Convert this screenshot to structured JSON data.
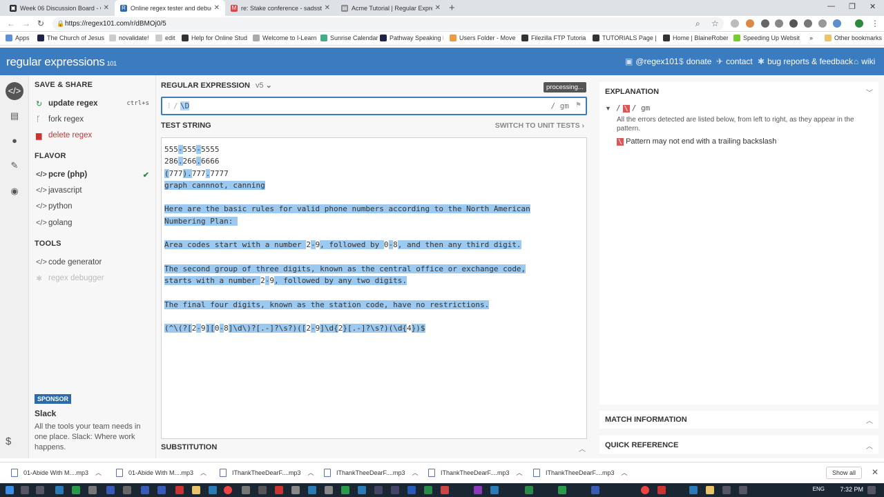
{
  "browser": {
    "tabs": [
      {
        "title": "Week 06 Discussion Board - CIT",
        "color": "#222"
      },
      {
        "title": "Online regex tester and debugge",
        "color": "#2d6aa8"
      },
      {
        "title": "re: Stake conference - sadsster@",
        "color": "#d44"
      },
      {
        "title": "Acme Tutorial | Regular Expressio",
        "color": "#666"
      }
    ],
    "url": "https://regex101.com/r/dBMOj0/5",
    "bookmarks": [
      {
        "label": "Apps",
        "color": "#5f8fd8"
      },
      {
        "label": "The Church of Jesus",
        "color": "#224"
      },
      {
        "label": "novalidate!",
        "color": "#999"
      },
      {
        "label": "edit",
        "color": "#999"
      },
      {
        "label": "Help for Online Stud",
        "color": "#333"
      },
      {
        "label": "Welcome to I-Learn",
        "color": "#aaa"
      },
      {
        "label": "Sunrise Calendar",
        "color": "#4a8"
      },
      {
        "label": "Pathway Speaking Pa",
        "color": "#224"
      },
      {
        "label": "Users Folder - Move",
        "color": "#e94"
      },
      {
        "label": "Filezilla FTP Tutorial",
        "color": "#333"
      },
      {
        "label": "TUTORIALS Page | Bl",
        "color": "#333"
      },
      {
        "label": "Home | BlaineRobert",
        "color": "#333"
      },
      {
        "label": "Speeding Up Websit",
        "color": "#7c3"
      },
      {
        "label": "Other bookmarks",
        "color": "#e9c46a"
      }
    ]
  },
  "header": {
    "logo_main": "regular expressions",
    "logo_sub": "101",
    "links": [
      {
        "label": "@regex101",
        "icon": "twitter-icon",
        "glyph": "▣"
      },
      {
        "label": "donate",
        "icon": "dollar-icon",
        "glyph": "$"
      },
      {
        "label": "contact",
        "icon": "send-icon",
        "glyph": "✈"
      },
      {
        "label": "bug reports & feedback",
        "icon": "bug-icon",
        "glyph": "✱"
      },
      {
        "label": "wiki",
        "icon": "bank-icon",
        "glyph": "⌂"
      }
    ]
  },
  "left": {
    "save_share": "SAVE & SHARE",
    "update_regex": "update regex",
    "update_shortcut": "ctrl+s",
    "fork_regex": "fork regex",
    "delete_regex": "delete regex",
    "flavor": "FLAVOR",
    "flavors": [
      "pcre (php)",
      "javascript",
      "python",
      "golang"
    ],
    "tools": "TOOLS",
    "code_generator": "code generator",
    "regex_debugger": "regex debugger",
    "sponsor_badge": "SPONSOR",
    "sponsor_name": "Slack",
    "sponsor_text": "All the tools your team needs in one place. Slack: Where work happens."
  },
  "center": {
    "regex_title": "REGULAR EXPRESSION",
    "version": "v5",
    "processing": "processing...",
    "delim_open": "/",
    "pattern": "\\D",
    "flags": "/ gm",
    "test_title": "TEST STRING",
    "unit_tests": "SWITCH TO UNIT TESTS",
    "substitution": "SUBSTITUTION"
  },
  "test_lines": [
    {
      "segs": [
        [
          "555",
          false
        ],
        [
          "-",
          true
        ],
        [
          "555",
          false
        ],
        [
          "-",
          true
        ],
        [
          "5555",
          false
        ]
      ]
    },
    {
      "segs": [
        [
          "286",
          false
        ],
        [
          ".",
          true
        ],
        [
          "266",
          false
        ],
        [
          ".",
          true
        ],
        [
          "6666",
          false
        ]
      ]
    },
    {
      "segs": [
        [
          "(",
          true
        ],
        [
          "777",
          false
        ],
        [
          ")",
          true
        ],
        [
          ".",
          true
        ],
        [
          "777",
          false
        ],
        [
          ".",
          true
        ],
        [
          "7777",
          false
        ]
      ]
    },
    {
      "segs": [
        [
          "graph cannnot, canning",
          true
        ]
      ]
    },
    {
      "segs": []
    },
    {
      "segs": [
        [
          "Here are the basic rules for valid phone numbers according to the North American",
          true
        ]
      ]
    },
    {
      "segs": [
        [
          "Numbering Plan:",
          true
        ],
        [
          " ",
          true
        ]
      ]
    },
    {
      "segs": []
    },
    {
      "segs": [
        [
          "Area codes start with a number ",
          true
        ],
        [
          "2",
          false
        ],
        [
          "-",
          true
        ],
        [
          "9",
          false
        ],
        [
          ", followed by ",
          true
        ],
        [
          "0",
          false
        ],
        [
          "-",
          true
        ],
        [
          "8",
          false
        ],
        [
          ", and then any third digit.",
          true
        ]
      ]
    },
    {
      "segs": []
    },
    {
      "segs": [
        [
          "The second group of three digits, known as the central office or exchange code,",
          true
        ]
      ]
    },
    {
      "segs": [
        [
          "starts with a number ",
          true
        ],
        [
          "2",
          false
        ],
        [
          "-",
          true
        ],
        [
          "9",
          false
        ],
        [
          ", followed by any two digits.",
          true
        ]
      ]
    },
    {
      "segs": []
    },
    {
      "segs": [
        [
          "The final four digits, known as the station code, have no restrictions.",
          true
        ]
      ]
    },
    {
      "segs": []
    },
    {
      "segs": [
        [
          "(^\\(?[",
          true
        ],
        [
          "2",
          false
        ],
        [
          "-",
          true
        ],
        [
          "9",
          false
        ],
        [
          "][",
          true
        ],
        [
          "0",
          false
        ],
        [
          "-",
          true
        ],
        [
          "8",
          false
        ],
        [
          "]\\d\\)?[.-]?\\s?)([",
          true
        ],
        [
          "2",
          false
        ],
        [
          "-",
          true
        ],
        [
          "9",
          false
        ],
        [
          "]\\d{",
          true
        ],
        [
          "2",
          false
        ],
        [
          "}[.-]?\\s?)(\\d{",
          true
        ],
        [
          "4",
          false
        ],
        [
          "})$",
          true
        ]
      ]
    }
  ],
  "right": {
    "explanation": "EXPLANATION",
    "expl_delim_open": "/",
    "expl_pattern": "\\",
    "expl_delim_close": "/ gm",
    "expl_intro": "All the errors detected are listed below, from left to right, as they appear in the pattern.",
    "error_badge": "\\",
    "error_text": "Pattern may not end with a trailing backslash",
    "match_info": "MATCH INFORMATION",
    "quick_ref": "QUICK REFERENCE"
  },
  "downloads": {
    "items": [
      "01-Abide With M....mp3",
      "01-Abide With M....mp3",
      "IThankTheeDearF....mp3",
      "IThankTheeDearF....mp3",
      "IThankTheeDearF....mp3",
      "IThankTheeDearF....mp3"
    ],
    "show_all": "Show all"
  },
  "taskbar": {
    "lang": "ENG",
    "time": "7:32 PM"
  },
  "colors": {
    "brand": "#3b7bbf",
    "match_highlight": "#9cc9f0",
    "error": "#e05555",
    "success": "#2a8a4a"
  }
}
